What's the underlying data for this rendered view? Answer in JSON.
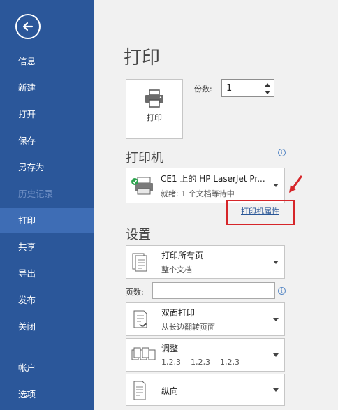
{
  "sidebar": {
    "items": [
      {
        "label": "信息"
      },
      {
        "label": "新建"
      },
      {
        "label": "打开"
      },
      {
        "label": "保存"
      },
      {
        "label": "另存为"
      },
      {
        "label": "历史记录"
      },
      {
        "label": "打印"
      },
      {
        "label": "共享"
      },
      {
        "label": "导出"
      },
      {
        "label": "发布"
      },
      {
        "label": "关闭"
      },
      {
        "label": "帐户"
      },
      {
        "label": "选项"
      }
    ],
    "active": "打印",
    "accent": "#2b579a"
  },
  "main": {
    "title": "打印",
    "print_button_label": "打印",
    "copies_label": "份数:",
    "copies_value": "1",
    "printer_section_title": "打印机",
    "printer": {
      "name": "CE1 上的 HP LaserJet Pr...",
      "status": "就绪: 1 个文档等待中",
      "properties_link": "打印机属性"
    },
    "settings_section_title": "设置",
    "settings": {
      "range_title": "打印所有页",
      "range_sub": "整个文档",
      "pages_label": "页数:",
      "pages_value": "",
      "duplex_title": "双面打印",
      "duplex_sub": "从长边翻转页面",
      "collate_title": "调整",
      "collate_sub": "1,2,3    1,2,3    1,2,3",
      "orientation_title": "纵向"
    }
  },
  "colors": {
    "highlight": "#d6262a",
    "link": "#2b5797"
  }
}
